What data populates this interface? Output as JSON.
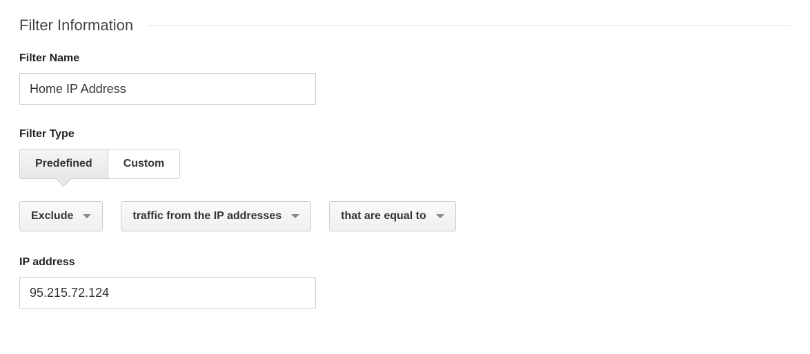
{
  "section": {
    "title": "Filter Information"
  },
  "filterName": {
    "label": "Filter Name",
    "value": "Home IP Address"
  },
  "filterType": {
    "label": "Filter Type",
    "tabs": {
      "predefined": "Predefined",
      "custom": "Custom"
    }
  },
  "dropdowns": {
    "action": "Exclude",
    "source": "traffic from the IP addresses",
    "match": "that are equal to"
  },
  "ipAddress": {
    "label": "IP address",
    "value": "95.215.72.124"
  }
}
